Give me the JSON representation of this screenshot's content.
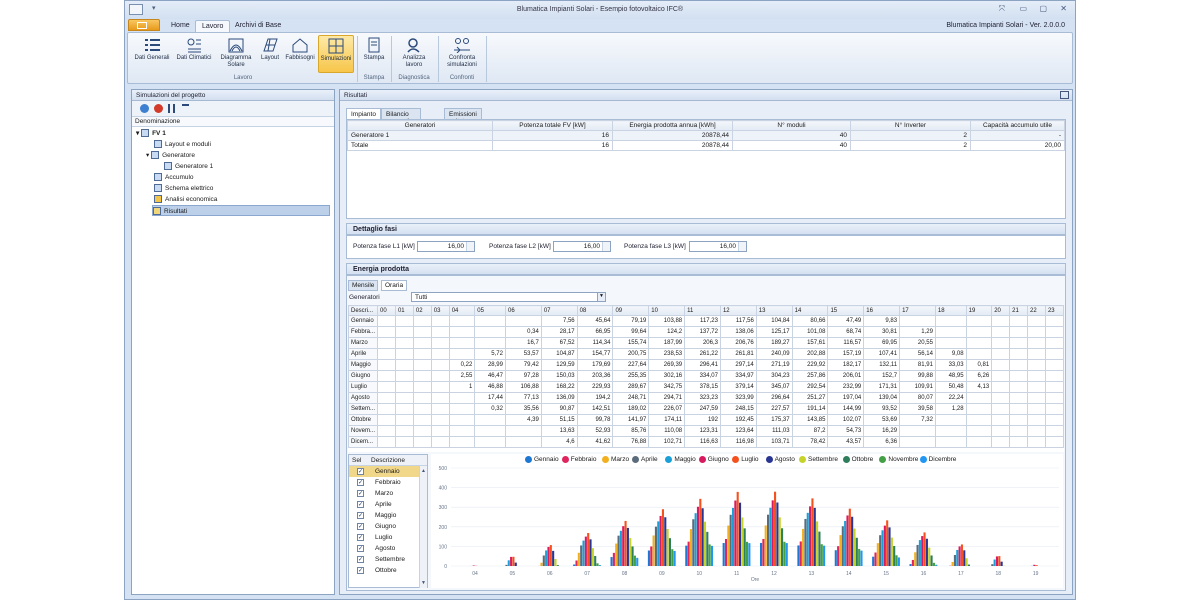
{
  "window": {
    "title": "Blumatica Impianti Solari - Esempio fotovoltaico IFC®",
    "version": "Blumatica Impianti Solari - Ver. 2.0.0.0"
  },
  "ribbon_tabs": [
    "Home",
    "Lavoro",
    "Archivi di Base"
  ],
  "ribbon": {
    "buttons": [
      "Dati Generali",
      "Dati Climatici",
      "Diagramma Solare",
      "Layout",
      "Fabbisogni",
      "Simulazioni",
      "Stampa",
      "Analizza lavoro",
      "Confronta simulazioni"
    ],
    "groups": [
      "Lavoro",
      "Stampa",
      "Diagnostica",
      "Confronti"
    ]
  },
  "left_panel": {
    "title": "Simulazioni del progetto",
    "column": "Denominazione",
    "tree": [
      "FV 1",
      "Layout e moduli",
      "Generatore",
      "Generatore 1",
      "Accumulo",
      "Schema elettrico",
      "Analisi economica",
      "Risultati"
    ]
  },
  "results": {
    "title": "Risultati",
    "tabs": [
      "Impianto",
      "Bilancio energetico",
      "Emissioni evitate"
    ],
    "impianto_headers": [
      "Generatori",
      "Potenza totale FV [kW]",
      "Energia prodotta annua [kWh]",
      "N° moduli",
      "N° Inverter",
      "Capacità accumulo utile"
    ],
    "impianto_rows": [
      [
        "Generatore 1",
        "16",
        "20878,44",
        "40",
        "2",
        "-"
      ],
      [
        "Totale",
        "16",
        "20878,44",
        "40",
        "2",
        "20,00"
      ]
    ]
  },
  "dettaglio_fasi": {
    "title": "Dettaglio fasi",
    "fields": [
      {
        "label": "Potenza fase L1 [kW]",
        "value": "16,00"
      },
      {
        "label": "Potenza fase L2 [kW]",
        "value": "16,00"
      },
      {
        "label": "Potenza fase L3 [kW]",
        "value": "16,00"
      }
    ]
  },
  "energia": {
    "title": "Energia prodotta",
    "tabs": [
      "Mensile",
      "Oraria"
    ],
    "generator_label": "Generatori",
    "generator_value": "Tutti",
    "hours_header": [
      "Descri...",
      "00",
      "01",
      "02",
      "03",
      "04",
      "05",
      "06",
      "07",
      "08",
      "09",
      "10",
      "11",
      "12",
      "13",
      "14",
      "15",
      "16",
      "17",
      "18",
      "19",
      "20",
      "21",
      "22",
      "23"
    ],
    "rows": [
      [
        "Gennaio",
        "",
        "",
        "",
        "",
        "",
        "",
        "",
        "7,56",
        "45,64",
        "79,19",
        "103,88",
        "117,23",
        "117,56",
        "104,84",
        "80,66",
        "47,49",
        "9,83",
        "",
        "",
        "",
        "",
        "",
        "",
        ""
      ],
      [
        "Febbra...",
        "",
        "",
        "",
        "",
        "",
        "",
        "0,34",
        "28,17",
        "66,95",
        "99,64",
        "124,2",
        "137,72",
        "138,06",
        "125,17",
        "101,08",
        "68,74",
        "30,81",
        "1,29",
        "",
        "",
        "",
        "",
        "",
        ""
      ],
      [
        "Marzo",
        "",
        "",
        "",
        "",
        "",
        "",
        "16,7",
        "67,52",
        "114,34",
        "155,74",
        "187,99",
        "206,3",
        "206,76",
        "189,27",
        "157,61",
        "116,57",
        "69,95",
        "20,55",
        "",
        "",
        "",
        "",
        "",
        ""
      ],
      [
        "Aprile",
        "",
        "",
        "",
        "",
        "",
        "5,72",
        "53,57",
        "104,87",
        "154,77",
        "200,75",
        "238,53",
        "261,22",
        "261,81",
        "240,09",
        "202,88",
        "157,19",
        "107,41",
        "56,14",
        "9,08",
        "",
        "",
        "",
        "",
        ""
      ],
      [
        "Maggio",
        "",
        "",
        "",
        "",
        "0,22",
        "28,99",
        "79,42",
        "129,59",
        "179,69",
        "227,64",
        "269,39",
        "296,41",
        "297,14",
        "271,19",
        "229,92",
        "182,17",
        "132,11",
        "81,91",
        "33,03",
        "0,81",
        "",
        "",
        "",
        ""
      ],
      [
        "Giugno",
        "",
        "",
        "",
        "",
        "2,55",
        "46,47",
        "97,28",
        "150,03",
        "203,36",
        "255,35",
        "302,16",
        "334,07",
        "334,97",
        "304,23",
        "257,86",
        "206,01",
        "152,7",
        "99,88",
        "48,95",
        "6,26",
        "",
        "",
        "",
        ""
      ],
      [
        "Luglio",
        "",
        "",
        "",
        "",
        "1",
        "46,88",
        "106,88",
        "168,22",
        "229,93",
        "289,67",
        "342,75",
        "378,15",
        "379,14",
        "345,07",
        "292,54",
        "232,99",
        "171,31",
        "109,91",
        "50,48",
        "4,13",
        "",
        "",
        "",
        ""
      ],
      [
        "Agosto",
        "",
        "",
        "",
        "",
        "",
        "17,44",
        "77,13",
        "136,09",
        "194,2",
        "248,71",
        "294,71",
        "323,23",
        "323,99",
        "296,64",
        "251,27",
        "197,04",
        "139,04",
        "80,07",
        "22,24",
        "",
        "",
        "",
        "",
        ""
      ],
      [
        "Settem...",
        "",
        "",
        "",
        "",
        "",
        "0,32",
        "35,56",
        "90,87",
        "142,51",
        "189,02",
        "226,07",
        "247,59",
        "248,15",
        "227,57",
        "191,14",
        "144,99",
        "93,52",
        "39,58",
        "1,28",
        "",
        "",
        "",
        "",
        ""
      ],
      [
        "Ottobre",
        "",
        "",
        "",
        "",
        "",
        "",
        "4,39",
        "51,15",
        "99,78",
        "141,97",
        "174,11",
        "192",
        "192,45",
        "175,37",
        "143,85",
        "102,07",
        "53,69",
        "7,32",
        "",
        "",
        "",
        "",
        "",
        ""
      ],
      [
        "Novem...",
        "",
        "",
        "",
        "",
        "",
        "",
        "",
        "13,63",
        "52,93",
        "85,76",
        "110,08",
        "123,31",
        "123,64",
        "111,03",
        "87,2",
        "54,73",
        "16,29",
        "",
        "",
        "",
        "",
        "",
        "",
        ""
      ],
      [
        "Dicem...",
        "",
        "",
        "",
        "",
        "",
        "",
        "",
        "4,6",
        "41,62",
        "76,88",
        "102,71",
        "116,63",
        "116,98",
        "103,71",
        "78,42",
        "43,57",
        "6,36",
        "",
        "",
        "",
        "",
        "",
        "",
        ""
      ]
    ],
    "series_list_headers": [
      "Sel",
      "Descrizione"
    ],
    "series_list": [
      "Gennaio",
      "Febbraio",
      "Marzo",
      "Aprile",
      "Maggio",
      "Giugno",
      "Luglio",
      "Agosto",
      "Settembre",
      "Ottobre"
    ]
  },
  "chart_data": {
    "type": "bar",
    "xlabel": "Ore",
    "ylabel": "",
    "ylim": [
      0,
      500
    ],
    "yticks": [
      "500",
      "400",
      "300",
      "200",
      "100",
      "0"
    ],
    "categories": [
      "04",
      "05",
      "06",
      "07",
      "08",
      "09",
      "10",
      "11",
      "12",
      "13",
      "14",
      "15",
      "16",
      "17",
      "18",
      "19"
    ],
    "series": [
      {
        "name": "Gennaio",
        "color": "#1f77d4",
        "values": [
          0,
          0,
          0,
          7.56,
          45.64,
          79.19,
          103.88,
          117.23,
          117.56,
          104.84,
          80.66,
          47.49,
          9.83,
          0,
          0,
          0
        ]
      },
      {
        "name": "Febbraio",
        "color": "#e0245e",
        "values": [
          0,
          0,
          0.34,
          28.17,
          66.95,
          99.64,
          124.2,
          137.72,
          138.06,
          125.17,
          101.08,
          68.74,
          30.81,
          1.29,
          0,
          0
        ]
      },
      {
        "name": "Marzo",
        "color": "#f2b01e",
        "values": [
          0,
          0,
          16.7,
          67.52,
          114.34,
          155.74,
          187.99,
          206.3,
          206.76,
          189.27,
          157.61,
          116.57,
          69.95,
          20.55,
          0,
          0
        ]
      },
      {
        "name": "Aprile",
        "color": "#5a6b7b",
        "values": [
          0,
          5.72,
          53.57,
          104.87,
          154.77,
          200.75,
          238.53,
          261.22,
          261.81,
          240.09,
          202.88,
          157.19,
          107.41,
          56.14,
          9.08,
          0
        ]
      },
      {
        "name": "Maggio",
        "color": "#1aa0d8",
        "values": [
          0.22,
          28.99,
          79.42,
          129.59,
          179.69,
          227.64,
          269.39,
          296.41,
          297.14,
          271.19,
          229.92,
          182.17,
          132.11,
          81.91,
          33.03,
          0.81
        ]
      },
      {
        "name": "Giugno",
        "color": "#d81b60",
        "values": [
          2.55,
          46.47,
          97.28,
          150.03,
          203.36,
          255.35,
          302.16,
          334.07,
          334.97,
          304.23,
          257.86,
          206.01,
          152.7,
          99.88,
          48.95,
          6.26
        ]
      },
      {
        "name": "Luglio",
        "color": "#f4511e",
        "values": [
          1,
          46.88,
          106.88,
          168.22,
          229.93,
          289.67,
          342.75,
          378.15,
          379.14,
          345.07,
          292.54,
          232.99,
          171.31,
          109.91,
          50.48,
          4.13
        ]
      },
      {
        "name": "Agosto",
        "color": "#283593",
        "values": [
          0,
          17.44,
          77.13,
          136.09,
          194.2,
          248.71,
          294.71,
          323.23,
          323.99,
          296.64,
          251.27,
          197.04,
          139.04,
          80.07,
          22.24,
          0
        ]
      },
      {
        "name": "Settembre",
        "color": "#c6d32a",
        "values": [
          0,
          0.32,
          35.56,
          90.87,
          142.51,
          189.02,
          226.07,
          247.59,
          248.15,
          227.57,
          191.14,
          144.99,
          93.52,
          39.58,
          1.28,
          0
        ]
      },
      {
        "name": "Ottobre",
        "color": "#2e7d5b",
        "values": [
          0,
          0,
          4.39,
          51.15,
          99.78,
          141.97,
          174.11,
          192,
          192.45,
          175.37,
          143.85,
          102.07,
          53.69,
          7.32,
          0,
          0
        ]
      },
      {
        "name": "Novembre",
        "color": "#43a047",
        "values": [
          0,
          0,
          0,
          13.63,
          52.93,
          85.76,
          110.08,
          123.31,
          123.64,
          111.03,
          87.2,
          54.73,
          16.29,
          0,
          0,
          0
        ]
      },
      {
        "name": "Dicembre",
        "color": "#2196f3",
        "values": [
          0,
          0,
          0,
          4.6,
          41.62,
          76.88,
          102.71,
          116.63,
          116.98,
          103.71,
          78.42,
          43.57,
          6.36,
          0,
          0,
          0
        ]
      }
    ]
  }
}
